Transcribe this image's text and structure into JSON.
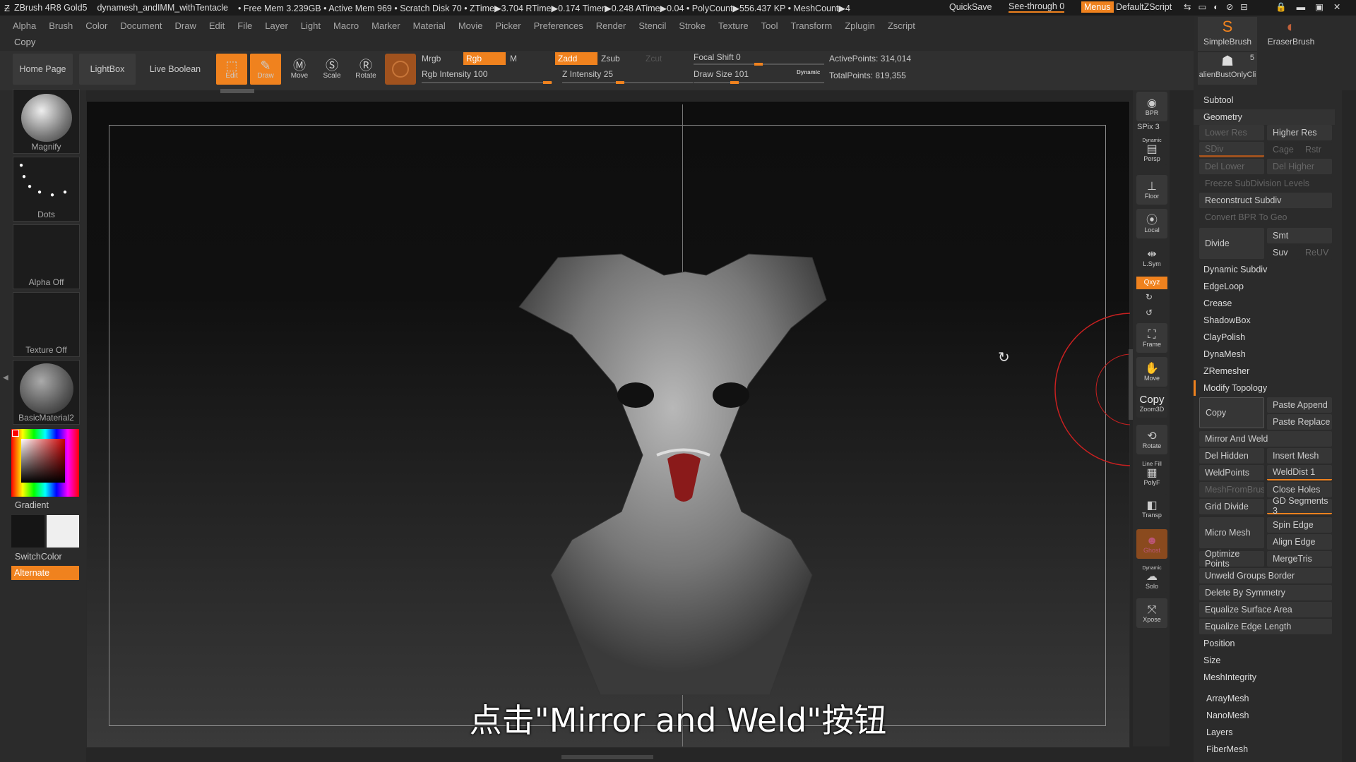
{
  "titlebar": {
    "app": "ZBrush 4R8 Gold5",
    "file": "dynamesh_andIMM_withTentacle",
    "stats": "• Free Mem 3.239GB • Active Mem 969 • Scratch Disk 70 • ZTime▶3.704 RTime▶0.174 Timer▶0.248 ATime▶0.04 • PolyCount▶556.437 KP • MeshCount▶4",
    "quicksave": "QuickSave",
    "seethrough": "See-through  0",
    "menus": "Menus",
    "script": "DefaultZScript"
  },
  "menu": [
    "Alpha",
    "Brush",
    "Color",
    "Document",
    "Draw",
    "Edit",
    "File",
    "Layer",
    "Light",
    "Macro",
    "Marker",
    "Material",
    "Movie",
    "Picker",
    "Preferences",
    "Render",
    "Stencil",
    "Stroke",
    "Texture",
    "Tool",
    "Transform",
    "Zplugin",
    "Zscript"
  ],
  "copy_label": "Copy",
  "toolbar": {
    "home": "Home Page",
    "lightbox": "LightBox",
    "liveboolean": "Live Boolean",
    "edit": "Edit",
    "draw": "Draw",
    "move": "Move",
    "scale": "Scale",
    "rotate": "Rotate",
    "mrgb": "Mrgb",
    "rgb": "Rgb",
    "m": "M",
    "zadd": "Zadd",
    "zsub": "Zsub",
    "zcut": "Zcut",
    "rgb_intensity": "Rgb Intensity 100",
    "z_intensity": "Z Intensity 25",
    "focal_shift": "Focal Shift 0",
    "draw_size": "Draw Size 101",
    "dynamic": "Dynamic",
    "active_points": "ActivePoints: 314,014",
    "total_points": "TotalPoints: 819,355"
  },
  "left": {
    "magnify": "Magnify",
    "dots": "Dots",
    "alpha": "Alpha Off",
    "texture": "Texture Off",
    "material": "BasicMaterial2",
    "gradient": "Gradient",
    "switchcolor": "SwitchColor",
    "alternate": "Alternate"
  },
  "shelf": {
    "bpr": "BPR",
    "spix": "SPix 3",
    "dynamic": "Dynamic",
    "persp": "Persp",
    "floor": "Floor",
    "local": "Local",
    "lsym": "L.Sym",
    "xyz": "Qxyz",
    "frame": "Frame",
    "move": "Move",
    "copy_tip": "Copy",
    "zoom3d": "Zoom3D",
    "rotate": "Rotate",
    "linefill": "Line Fill",
    "polyf": "PolyF",
    "transp": "Transp",
    "ghost": "Ghost",
    "dynamic2": "Dynamic",
    "solo": "Solo",
    "xpose": "Xpose"
  },
  "brushes": {
    "simple": "SimpleBrush",
    "eraser": "EraserBrush",
    "alien": "alienBustOnlyCli",
    "count": "5"
  },
  "panel": {
    "subtool": "Subtool",
    "geometry": "Geometry",
    "lower_res": "Lower Res",
    "higher_res": "Higher Res",
    "sdiv": "SDiv",
    "cage": "Cage",
    "rstr": "Rstr",
    "del_lower": "Del Lower",
    "del_higher": "Del Higher",
    "freeze": "Freeze SubDivision Levels",
    "reconstruct": "Reconstruct Subdiv",
    "convert_bpr": "Convert BPR To Geo",
    "divide": "Divide",
    "smt": "Smt",
    "suv": "Suv",
    "reuv": "ReUV",
    "dynamic_subdiv": "Dynamic Subdiv",
    "edgeloop": "EdgeLoop",
    "crease": "Crease",
    "shadowbox": "ShadowBox",
    "claypolish": "ClayPolish",
    "dynamesh": "DynaMesh",
    "zremesher": "ZRemesher",
    "modify_topology": "Modify Topology",
    "copy": "Copy",
    "paste_append": "Paste Append",
    "paste_replace": "Paste Replace",
    "mirror_weld": "Mirror And Weld",
    "del_hidden": "Del Hidden",
    "insert_mesh": "Insert Mesh",
    "weldpoints": "WeldPoints",
    "welddist": "WeldDist 1",
    "meshfrombrush": "MeshFromBrush",
    "close_holes": "Close Holes",
    "grid_divide": "Grid Divide",
    "gd_segments": "GD Segments 3",
    "micro_mesh": "Micro Mesh",
    "spin_edge": "Spin Edge",
    "align_edge": "Align Edge",
    "optimize_points": "Optimize Points",
    "mergetris": "MergeTris",
    "unweld": "Unweld Groups Border",
    "delete_sym": "Delete By Symmetry",
    "equalize_surface": "Equalize Surface Area",
    "equalize_edge": "Equalize Edge Length",
    "position": "Position",
    "size": "Size",
    "meshintegrity": "MeshIntegrity",
    "arraymesh": "ArrayMesh",
    "nanomesh": "NanoMesh",
    "layers": "Layers",
    "fibermesh": "FiberMesh"
  },
  "subtitle": "点击\"Mirror and Weld\"按钮"
}
